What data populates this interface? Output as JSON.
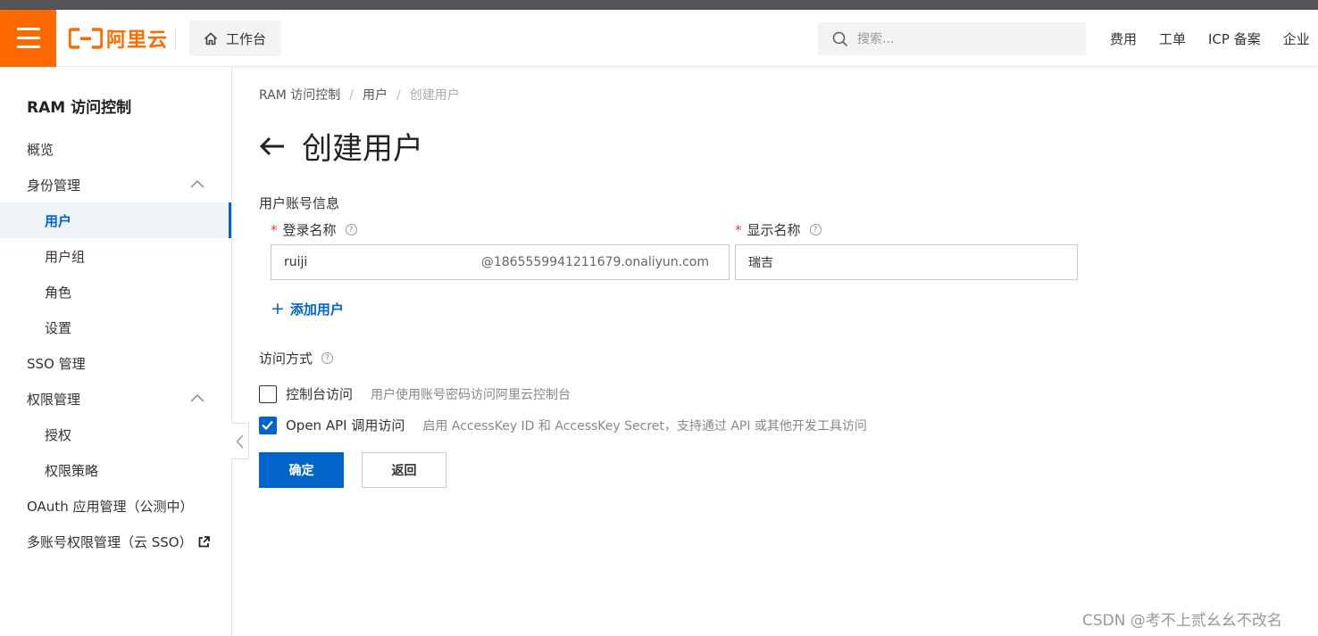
{
  "header": {
    "brand": "阿里云",
    "workbench_label": "工作台",
    "search_placeholder": "搜索...",
    "links": [
      "费用",
      "工单",
      "ICP 备案",
      "企业"
    ]
  },
  "sidebar": {
    "title": "RAM 访问控制",
    "items": [
      {
        "label": "概览"
      },
      {
        "label": "身份管理"
      },
      {
        "label": "用户"
      },
      {
        "label": "用户组"
      },
      {
        "label": "角色"
      },
      {
        "label": "设置"
      },
      {
        "label": "SSO 管理"
      },
      {
        "label": "权限管理"
      },
      {
        "label": "授权"
      },
      {
        "label": "权限策略"
      },
      {
        "label": "OAuth 应用管理（公测中）"
      },
      {
        "label": "多账号权限管理（云 SSO）"
      }
    ]
  },
  "breadcrumb": [
    "RAM 访问控制",
    "用户",
    "创建用户"
  ],
  "page_title": "创建用户",
  "form": {
    "section_account": "用户账号信息",
    "login_name_label": "登录名称",
    "login_name_value": "ruiji",
    "login_name_suffix": "@1865559941211679.onaliyun.com",
    "display_name_label": "显示名称",
    "display_name_value": "瑞吉",
    "add_user_label": "添加用户",
    "section_access": "访问方式",
    "access_options": [
      {
        "label": "控制台访问",
        "desc": "用户使用账号密码访问阿里云控制台",
        "checked": false
      },
      {
        "label": "Open API 调用访问",
        "desc": "启用 AccessKey ID 和 AccessKey Secret，支持通过 API 或其他开发工具访问",
        "checked": true
      }
    ],
    "confirm_label": "确定",
    "back_label": "返回"
  },
  "watermark": "CSDN @考不上贰幺幺不改名",
  "colors": {
    "brand_orange": "#ff6a00",
    "primary_blue": "#0064c8"
  }
}
